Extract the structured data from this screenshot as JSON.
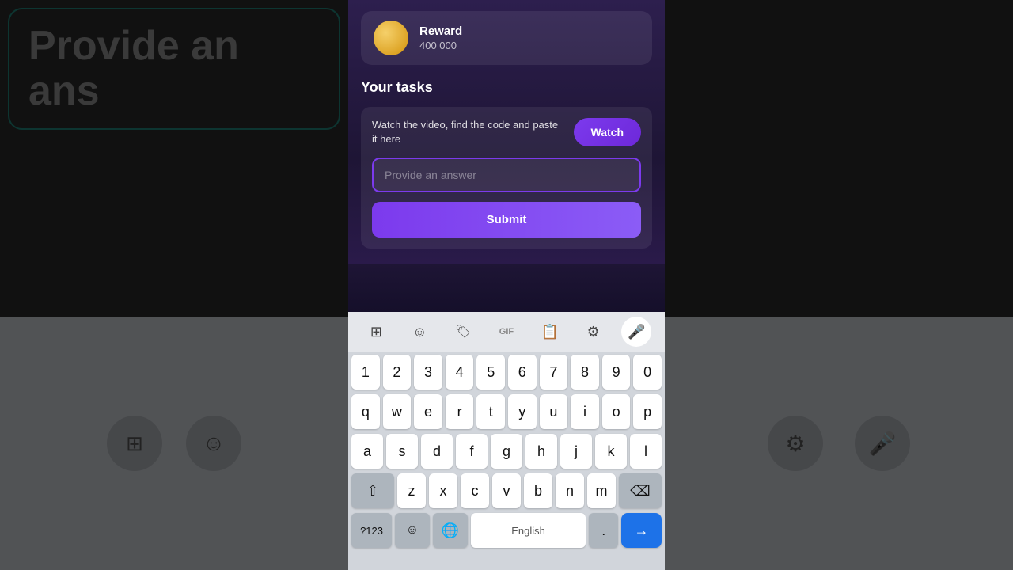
{
  "background": {
    "left_text": "Provide an ans",
    "color": "#111111"
  },
  "reward": {
    "label": "Reward",
    "value": "400 000"
  },
  "tasks": {
    "heading": "Your tasks",
    "description": "Watch the video, find the code and paste it here",
    "watch_button": "Watch",
    "input_placeholder": "Provide an answer",
    "submit_button": "Submit"
  },
  "keyboard": {
    "toolbar": {
      "grid_icon": "⊞",
      "emoji_icon": "☺",
      "sticker_icon": "🏷",
      "gif_label": "GIF",
      "clipboard_icon": "📋",
      "settings_icon": "⚙",
      "mic_icon": "🎤"
    },
    "rows": {
      "numbers": [
        "1",
        "2",
        "3",
        "4",
        "5",
        "6",
        "7",
        "8",
        "9",
        "0"
      ],
      "row1": [
        "q",
        "w",
        "e",
        "r",
        "t",
        "y",
        "u",
        "i",
        "o",
        "p"
      ],
      "row2": [
        "a",
        "s",
        "d",
        "f",
        "g",
        "h",
        "j",
        "k",
        "l"
      ],
      "row3": [
        "z",
        "x",
        "c",
        "v",
        "b",
        "n",
        "m"
      ],
      "bottom": {
        "num_sym": "?123",
        "emoji": "☺",
        "globe": "🌐",
        "space": "English",
        "period": ".",
        "enter_arrow": "→"
      }
    }
  }
}
